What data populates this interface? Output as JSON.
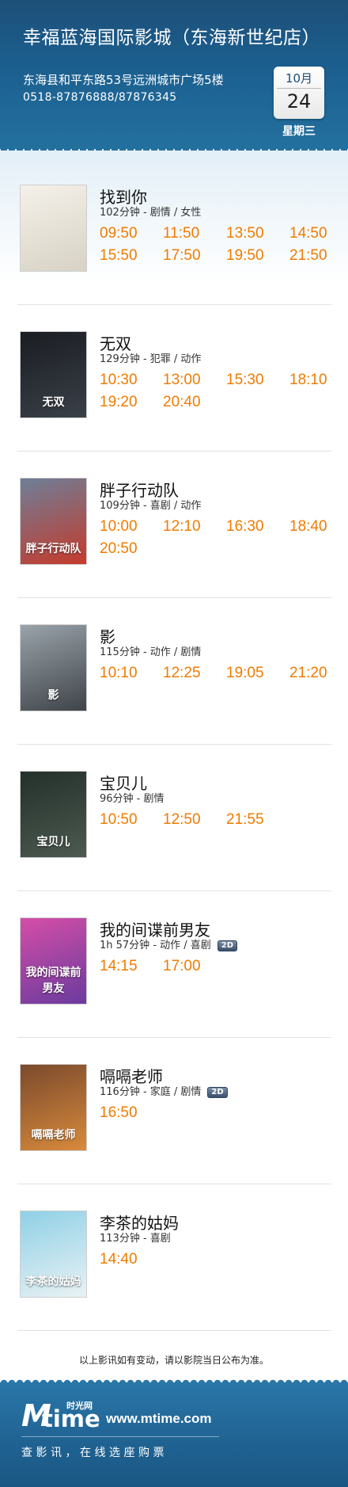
{
  "cinema": {
    "name": "幸福蓝海国际影城（东海新世纪店）",
    "address": "东海县和平东路53号远洲城市广场5楼",
    "phone": "0518-87876888/87876345"
  },
  "date": {
    "month": "10月",
    "day": "24",
    "weekday": "星期三"
  },
  "movies": [
    {
      "title": "找到你",
      "meta": "102分钟 - 剧情 / 女性",
      "badge": "",
      "poster_text": "",
      "poster_colors": [
        "#f4f1ea",
        "#d7d2c4"
      ],
      "times": [
        "09:50",
        "11:50",
        "13:50",
        "14:50",
        "15:50",
        "17:50",
        "19:50",
        "21:50"
      ]
    },
    {
      "title": "无双",
      "meta": "129分钟 - 犯罪 / 动作",
      "badge": "",
      "poster_text": "无双",
      "poster_colors": [
        "#1a1d22",
        "#3a4048"
      ],
      "times": [
        "10:30",
        "13:00",
        "15:30",
        "18:10",
        "19:20",
        "20:40"
      ]
    },
    {
      "title": "胖子行动队",
      "meta": "109分钟 - 喜剧 / 动作",
      "badge": "",
      "poster_text": "胖子行动队",
      "poster_colors": [
        "#6d7f98",
        "#c63a2c"
      ],
      "times": [
        "10:00",
        "12:10",
        "16:30",
        "18:40",
        "20:50"
      ]
    },
    {
      "title": "影",
      "meta": "115分钟 - 动作 / 剧情",
      "badge": "",
      "poster_text": "影",
      "poster_colors": [
        "#9aa3aa",
        "#3f4449"
      ],
      "times": [
        "10:10",
        "12:25",
        "19:05",
        "21:20"
      ]
    },
    {
      "title": "宝贝儿",
      "meta": "96分钟 - 剧情",
      "badge": "",
      "poster_text": "宝贝儿",
      "poster_colors": [
        "#24302a",
        "#4c5a51"
      ],
      "times": [
        "10:50",
        "12:50",
        "21:55"
      ]
    },
    {
      "title": "我的间谍前男友",
      "meta": "1h 57分钟 - 动作 / 喜剧",
      "badge": "2D",
      "poster_text": "我的间谍前男友",
      "poster_colors": [
        "#d44ea7",
        "#6b3b9e"
      ],
      "times": [
        "14:15",
        "17:00"
      ]
    },
    {
      "title": "嗝嗝老师",
      "meta": "116分钟 - 家庭 / 剧情",
      "badge": "2D",
      "poster_text": "嗝嗝老师",
      "poster_colors": [
        "#7a4a2c",
        "#d98a3c"
      ],
      "times": [
        "16:50"
      ]
    },
    {
      "title": "李茶的姑妈",
      "meta": "113分钟 - 喜剧",
      "badge": "",
      "poster_text": "李茶的姑妈",
      "poster_colors": [
        "#8fd0e6",
        "#e9f2f4"
      ],
      "times": [
        "14:40"
      ]
    }
  ],
  "note": "以上影讯如有变动，请以影院当日公布为准。",
  "footer": {
    "brand_m": "M",
    "brand_time": "time",
    "brand_cn": "时光网",
    "site": "www.mtime.com",
    "slogan": "查影讯，在线选座购票"
  }
}
